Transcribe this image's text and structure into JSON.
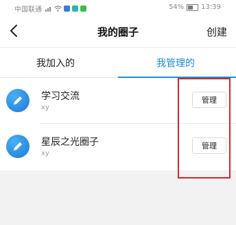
{
  "status_bar": {
    "carrier": "中国联通",
    "battery_percent": "54%",
    "time": "13:39"
  },
  "nav": {
    "title": "我的圈子",
    "action_label": "创建",
    "back_icon": "chevron-left-icon"
  },
  "tabs": [
    {
      "label": "我加入的",
      "active": false
    },
    {
      "label": "我管理的",
      "active": true
    }
  ],
  "circles": [
    {
      "name": "学习交流",
      "owner": "xy",
      "action_label": "管理"
    },
    {
      "name": "星辰之光圈子",
      "owner": "xy",
      "action_label": "管理"
    }
  ],
  "colors": {
    "accent": "#1a8cd8",
    "highlight": "#d8232a",
    "background": "#f2f2f2"
  }
}
